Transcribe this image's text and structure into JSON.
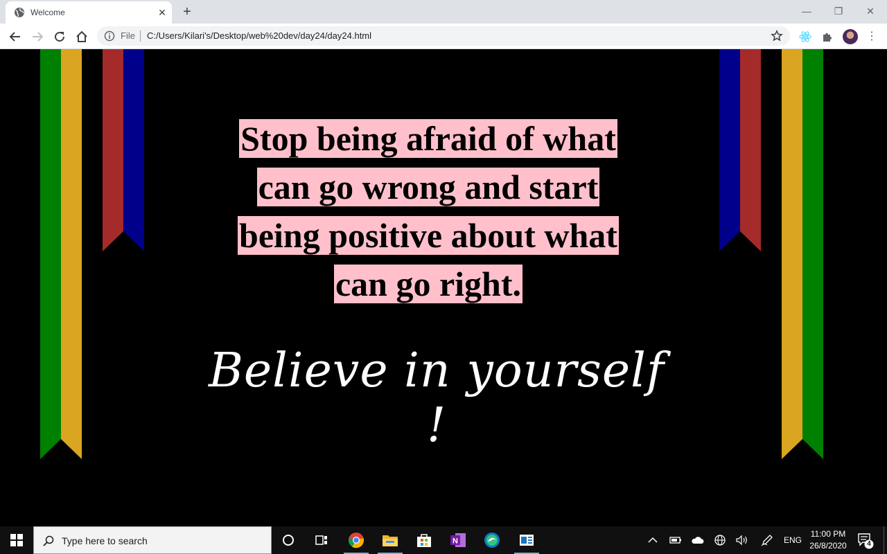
{
  "browser": {
    "tab_title": "Welcome",
    "new_tab_symbol": "+",
    "window": {
      "minimize": "—",
      "restore": "❐",
      "close": "✕"
    },
    "omnibox": {
      "scheme_label": "File",
      "url": "C:/Users/Kilari's/Desktop/web%20dev/day24/day24.html"
    },
    "icons": [
      "globe-icon",
      "back-icon",
      "forward-icon",
      "reload-icon",
      "home-icon",
      "info-icon",
      "star-icon",
      "react-extension-icon",
      "puzzle-icon",
      "avatar",
      "more-icon"
    ]
  },
  "page": {
    "quote_lines": [
      "Stop being afraid of what",
      "can go wrong and start",
      "being positive about what",
      "can go right."
    ],
    "tagline": "Believe in yourself !",
    "colors": {
      "background": "#000000",
      "quote_highlight": "#ffc0cb",
      "ribbon_green": "#008000",
      "ribbon_gold": "#daa520",
      "ribbon_red": "#a52a2a",
      "ribbon_blue": "#00008b"
    }
  },
  "taskbar": {
    "search_placeholder": "Type here to search",
    "language": "ENG",
    "time": "11:00 PM",
    "date": "26/8/2020",
    "notification_count": "4",
    "pinned_apps": [
      "cortana-icon",
      "task-view-icon",
      "chrome-icon",
      "file-explorer-icon",
      "store-icon",
      "onenote-icon",
      "edge-icon",
      "app-icon"
    ]
  }
}
